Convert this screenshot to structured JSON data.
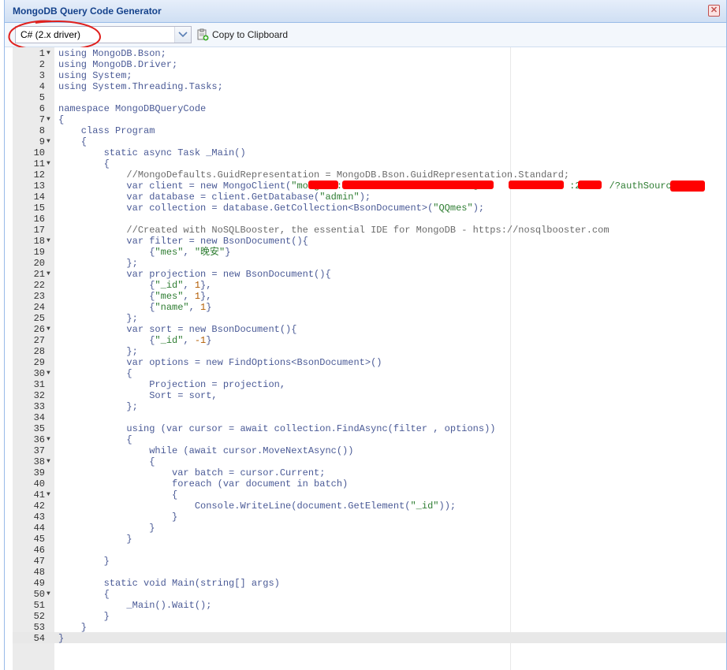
{
  "window": {
    "title": "MongoDB Query Code Generator",
    "close_glyph": "✕"
  },
  "toolbar": {
    "language_select": {
      "value": "C# (2.x driver)"
    },
    "copy_button": {
      "label": "Copy to Clipboard",
      "icon": "clipboard-copy-icon"
    }
  },
  "colors": {
    "accent": "#15428b",
    "annotation": "#e0201d",
    "redaction": "#ff0000"
  },
  "editor": {
    "active_line": 54,
    "lines": [
      {
        "n": "1",
        "fold": true,
        "text": "using MongoDB.Bson;"
      },
      {
        "n": "2",
        "fold": false,
        "text": "using MongoDB.Driver;"
      },
      {
        "n": "3",
        "fold": false,
        "text": "using System;"
      },
      {
        "n": "4",
        "fold": false,
        "text": "using System.Threading.Tasks;"
      },
      {
        "n": "5",
        "fold": false,
        "text": ""
      },
      {
        "n": "6",
        "fold": false,
        "text": "namespace MongoDBQueryCode"
      },
      {
        "n": "7",
        "fold": true,
        "text": "{"
      },
      {
        "n": "8",
        "fold": false,
        "text": "    class Program"
      },
      {
        "n": "9",
        "fold": true,
        "text": "    {"
      },
      {
        "n": "10",
        "fold": false,
        "text": "        static async Task _Main()"
      },
      {
        "n": "11",
        "fold": true,
        "text": "        {"
      },
      {
        "n": "12",
        "fold": false,
        "text": "            //MongoDefaults.GuidRepresentation = MongoDB.Bson.GuidRepresentation.Standard;"
      },
      {
        "n": "13",
        "fold": false,
        "text": "            var client = new MongoClient(\"mongodb:/                      @17              :27    /?authSource=        \");"
      },
      {
        "n": "14",
        "fold": false,
        "text": "            var database = client.GetDatabase(\"admin\");"
      },
      {
        "n": "15",
        "fold": false,
        "text": "            var collection = database.GetCollection<BsonDocument>(\"QQmes\");"
      },
      {
        "n": "16",
        "fold": false,
        "text": ""
      },
      {
        "n": "17",
        "fold": false,
        "text": "            //Created with NoSQLBooster, the essential IDE for MongoDB - https://nosqlbooster.com"
      },
      {
        "n": "18",
        "fold": true,
        "text": "            var filter = new BsonDocument(){"
      },
      {
        "n": "19",
        "fold": false,
        "text": "                {\"mes\", \"晚安\"}"
      },
      {
        "n": "20",
        "fold": false,
        "text": "            };"
      },
      {
        "n": "21",
        "fold": true,
        "text": "            var projection = new BsonDocument(){"
      },
      {
        "n": "22",
        "fold": false,
        "text": "                {\"_id\", 1},"
      },
      {
        "n": "23",
        "fold": false,
        "text": "                {\"mes\", 1},"
      },
      {
        "n": "24",
        "fold": false,
        "text": "                {\"name\", 1}"
      },
      {
        "n": "25",
        "fold": false,
        "text": "            };"
      },
      {
        "n": "26",
        "fold": true,
        "text": "            var sort = new BsonDocument(){"
      },
      {
        "n": "27",
        "fold": false,
        "text": "                {\"_id\", -1}"
      },
      {
        "n": "28",
        "fold": false,
        "text": "            };"
      },
      {
        "n": "29",
        "fold": false,
        "text": "            var options = new FindOptions<BsonDocument>()"
      },
      {
        "n": "30",
        "fold": true,
        "text": "            {"
      },
      {
        "n": "31",
        "fold": false,
        "text": "                Projection = projection,"
      },
      {
        "n": "32",
        "fold": false,
        "text": "                Sort = sort,"
      },
      {
        "n": "33",
        "fold": false,
        "text": "            };"
      },
      {
        "n": "34",
        "fold": false,
        "text": ""
      },
      {
        "n": "35",
        "fold": false,
        "text": "            using (var cursor = await collection.FindAsync(filter , options))"
      },
      {
        "n": "36",
        "fold": true,
        "text": "            {"
      },
      {
        "n": "37",
        "fold": false,
        "text": "                while (await cursor.MoveNextAsync())"
      },
      {
        "n": "38",
        "fold": true,
        "text": "                {"
      },
      {
        "n": "39",
        "fold": false,
        "text": "                    var batch = cursor.Current;"
      },
      {
        "n": "40",
        "fold": false,
        "text": "                    foreach (var document in batch)"
      },
      {
        "n": "41",
        "fold": true,
        "text": "                    {"
      },
      {
        "n": "42",
        "fold": false,
        "text": "                        Console.WriteLine(document.GetElement(\"_id\"));"
      },
      {
        "n": "43",
        "fold": false,
        "text": "                    }"
      },
      {
        "n": "44",
        "fold": false,
        "text": "                }"
      },
      {
        "n": "45",
        "fold": false,
        "text": "            }"
      },
      {
        "n": "46",
        "fold": false,
        "text": ""
      },
      {
        "n": "47",
        "fold": false,
        "text": "        }"
      },
      {
        "n": "48",
        "fold": false,
        "text": ""
      },
      {
        "n": "49",
        "fold": false,
        "text": "        static void Main(string[] args)"
      },
      {
        "n": "50",
        "fold": true,
        "text": "        {"
      },
      {
        "n": "51",
        "fold": false,
        "text": "            _Main().Wait();"
      },
      {
        "n": "52",
        "fold": false,
        "text": "        }"
      },
      {
        "n": "53",
        "fold": false,
        "text": "    }"
      },
      {
        "n": "54",
        "fold": false,
        "text": "}"
      }
    ]
  }
}
